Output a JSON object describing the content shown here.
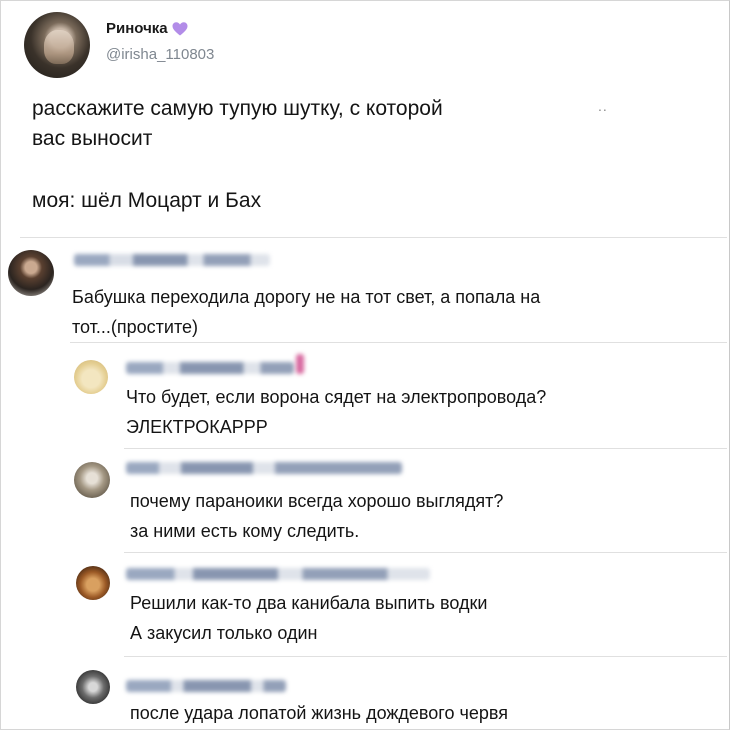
{
  "tweet": {
    "display_name": "Риночка",
    "handle": "@irisha_110803",
    "text_lines": [
      "расскажите самую тупую шутку, с которой",
      "вас выносит"
    ],
    "text_line2": "моя: шёл Моцарт и Бах",
    "heart_color": "#b28ce8",
    "dots": ".."
  },
  "replies": [
    {
      "avatar_icon": "profile-photo-icon",
      "text_lines": [
        "Бабушка переходила дорогу не на тот свет, а попала на",
        "тот...(простите)"
      ]
    },
    {
      "avatar_icon": "cat-face-icon",
      "text_lines": [
        "Что будет, если ворона сядет на электропровода?",
        "ЭЛЕКТРОКАРРР"
      ]
    },
    {
      "avatar_icon": "profile-photo-icon",
      "text_lines": [
        "почему параноики всегда хорошо выглядят?",
        "за ними есть кому следить."
      ]
    },
    {
      "avatar_icon": "dog-photo-icon",
      "text_lines": [
        "Решили как-то два канибала выпить водки",
        "А закусил только один"
      ]
    },
    {
      "avatar_icon": "profile-photo-icon",
      "text_lines": [
        "после удара лопатой жизнь дождевого червя"
      ]
    }
  ]
}
